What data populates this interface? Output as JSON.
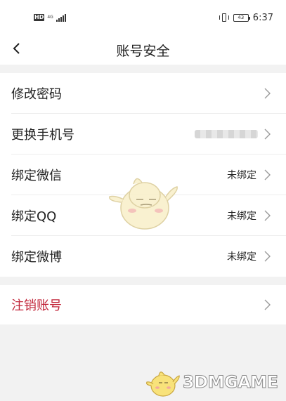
{
  "status_bar": {
    "hd_badge": "HD",
    "network": "4G",
    "time": "6:37",
    "battery": "43",
    "icons": [
      "signal-icon",
      "vibrate-icon",
      "battery-icon"
    ]
  },
  "header": {
    "title": "账号安全",
    "back_icon": "chevron-left-icon"
  },
  "items": [
    {
      "label": "修改密码",
      "value": ""
    },
    {
      "label": "更换手机号",
      "value": ""
    },
    {
      "label": "绑定微信",
      "value": "未绑定"
    },
    {
      "label": "绑定QQ",
      "value": "未绑定"
    },
    {
      "label": "绑定微博",
      "value": "未绑定"
    }
  ],
  "danger_item": {
    "label": "注销账号",
    "color": "#c2263a"
  },
  "watermark": {
    "text": "3DMGAME"
  },
  "colors": {
    "background": "#f2f2f2",
    "card": "#ffffff",
    "danger": "#c2263a"
  }
}
